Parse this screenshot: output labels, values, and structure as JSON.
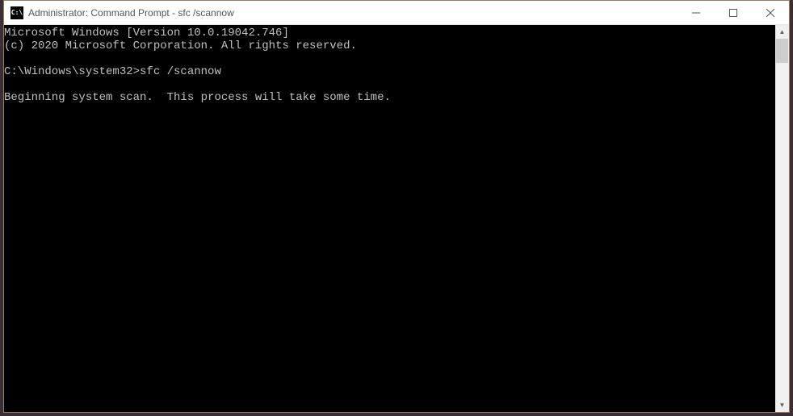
{
  "window": {
    "title": "Administrator: Command Prompt - sfc  /scannow",
    "icon_label": "C:\\"
  },
  "terminal": {
    "line1": "Microsoft Windows [Version 10.0.19042.746]",
    "line2": "(c) 2020 Microsoft Corporation. All rights reserved.",
    "blank1": "",
    "prompt_line": "C:\\Windows\\system32>sfc /scannow",
    "blank2": "",
    "status_line": "Beginning system scan.  This process will take some time."
  }
}
